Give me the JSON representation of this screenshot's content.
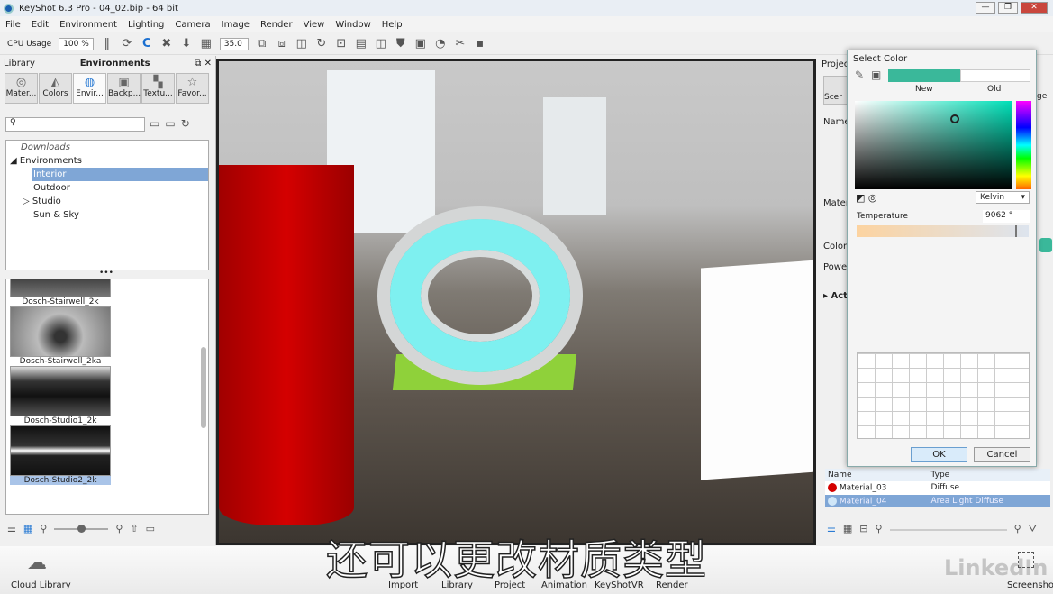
{
  "window": {
    "title": "KeyShot 6.3 Pro  - 04_02.bip  - 64 bit",
    "controls": [
      "—",
      "❐",
      "✕"
    ]
  },
  "menu": [
    "File",
    "Edit",
    "Environment",
    "Lighting",
    "Camera",
    "Image",
    "Render",
    "View",
    "Window",
    "Help"
  ],
  "toolbar": {
    "cpu_label": "CPU Usage",
    "cpu_value": "100 %",
    "focal_value": "35.0"
  },
  "library": {
    "title": "Library",
    "panel_title": "Environments",
    "tabs": [
      {
        "label": "Mater...",
        "icon": "material-icon",
        "glyph": "◎"
      },
      {
        "label": "Colors",
        "icon": "colors-icon",
        "glyph": "◭"
      },
      {
        "label": "Envir...",
        "icon": "globe-icon",
        "glyph": "◍"
      },
      {
        "label": "Backp...",
        "icon": "backplate-icon",
        "glyph": "▣"
      },
      {
        "label": "Textu...",
        "icon": "texture-icon",
        "glyph": "▚"
      },
      {
        "label": "Favor...",
        "icon": "star-icon",
        "glyph": "☆"
      }
    ],
    "search_placeholder": "",
    "tree": [
      {
        "label": "Downloads",
        "level": 0
      },
      {
        "label": "Environments",
        "level": 0,
        "expanded": true
      },
      {
        "label": "Interior",
        "level": 1,
        "selected": true
      },
      {
        "label": "Outdoor",
        "level": 1
      },
      {
        "label": "Studio",
        "level": 1,
        "collapsed": true
      },
      {
        "label": "Sun & Sky",
        "level": 1
      }
    ],
    "thumbnails": [
      {
        "label": "Dosch-Stairwell_2k"
      },
      {
        "label": "Dosch-Stairwell_2ka"
      },
      {
        "label": "Dosch-Studio1_2k"
      },
      {
        "label": "Dosch-Studio2_2k",
        "selected": true
      }
    ]
  },
  "project": {
    "title": "Projec",
    "tabs": [
      "Scer",
      "ge"
    ],
    "labels": {
      "name": "Name",
      "material": "Mater",
      "color": "Color",
      "power": "Powe",
      "action": "Act"
    },
    "color_value": "#3ab89a",
    "table": {
      "headers": [
        "Name",
        "Type"
      ],
      "rows": [
        {
          "name": "Material_03",
          "type": "Diffuse",
          "color": "#d40000"
        },
        {
          "name": "Material_04",
          "type": "Area Light Diffuse",
          "color": "#cfe6f8",
          "selected": true
        }
      ]
    }
  },
  "dialog": {
    "title": "Select Color",
    "new_label": "New",
    "old_label": "Old",
    "new_color": "#3ab89a",
    "old_color": "#ffffff",
    "mode": "Kelvin",
    "temperature_label": "Temperature",
    "temperature_value": "9062 °",
    "ok": "OK",
    "cancel": "Cancel"
  },
  "bottom": {
    "cloud_library": "Cloud Library",
    "buttons": [
      "Import",
      "Library",
      "Project",
      "Animation",
      "KeyShotVR",
      "Render"
    ],
    "screenshot": "Screenshot"
  },
  "subtitle": "还可以更改材质类型",
  "watermark": "LinkedIn"
}
